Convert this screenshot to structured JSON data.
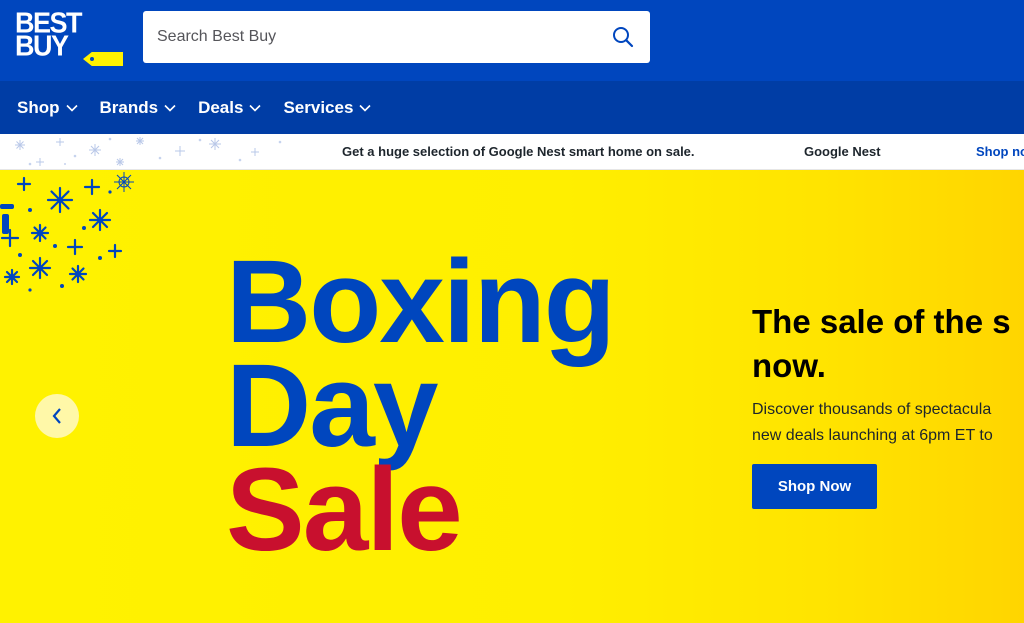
{
  "brand": {
    "logo_line1": "BEST",
    "logo_line2": "BUY",
    "primary_color": "#0046be",
    "nav_color": "#003da5",
    "accent_yellow": "#fff200",
    "accent_red": "#c8102e"
  },
  "search": {
    "placeholder": "Search Best Buy",
    "value": "",
    "icon": "search-icon"
  },
  "nav": {
    "items": [
      {
        "label": "Shop",
        "icon": "chevron-down-icon"
      },
      {
        "label": "Brands",
        "icon": "chevron-down-icon"
      },
      {
        "label": "Deals",
        "icon": "chevron-down-icon"
      },
      {
        "label": "Services",
        "icon": "chevron-down-icon"
      }
    ]
  },
  "promo": {
    "text": "Get a huge selection of Google Nest smart home on sale.",
    "brand": "Google Nest",
    "link": "Shop no"
  },
  "hero": {
    "title_line1": "Boxing",
    "title_line2": "Day",
    "title_line3": "Sale",
    "heading_line1": "The sale of the s",
    "heading_line2": "now.",
    "desc_line1": "Discover thousands of spectacula",
    "desc_line2": "new deals launching at 6pm ET to",
    "cta_label": "Shop Now",
    "prev_icon": "chevron-left-icon"
  }
}
